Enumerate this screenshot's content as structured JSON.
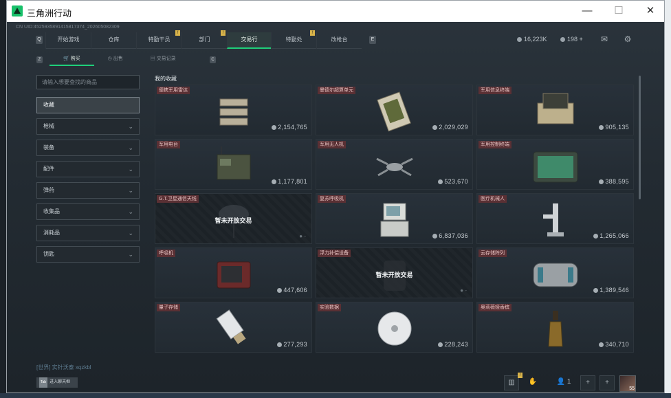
{
  "window": {
    "title": "三角洲行动",
    "min": "—",
    "max": "☐",
    "close": "✕"
  },
  "uid": "CN UID:4525935891415817374_202605082309",
  "nav": {
    "left_key": "Q",
    "right_key": "E",
    "tabs": [
      {
        "label": "开始游戏",
        "badge": ""
      },
      {
        "label": "仓库",
        "badge": ""
      },
      {
        "label": "特勤干员",
        "badge": "!"
      },
      {
        "label": "部门",
        "badge": "!"
      },
      {
        "label": "交易行",
        "badge": ""
      },
      {
        "label": "特勤处",
        "badge": "!"
      },
      {
        "label": "改枪台",
        "badge": ""
      }
    ]
  },
  "currency": {
    "hafu": "16,223K",
    "coupon": "198"
  },
  "subnav": {
    "left_key": "Z",
    "right_key": "C",
    "tabs": [
      "购买",
      "出售",
      "交易记录"
    ]
  },
  "search": {
    "placeholder": "请输入想要查找的商品"
  },
  "categories": [
    "收藏",
    "枪械",
    "装备",
    "配件",
    "弹药",
    "收集品",
    "消耗品",
    "钥匙"
  ],
  "section_title": "我的收藏",
  "locked_text": "暂未开放交易",
  "items": [
    {
      "name": "便携军用雷达",
      "price": "2,154,765",
      "icon": "radar-icon",
      "locked": false
    },
    {
      "name": "曼德尔超算单元",
      "price": "2,029,029",
      "icon": "circuit-board-icon",
      "locked": false
    },
    {
      "name": "军用信息终端",
      "price": "905,135",
      "icon": "terminal-case-icon",
      "locked": false
    },
    {
      "name": "军用电台",
      "price": "1,177,801",
      "icon": "radio-icon",
      "locked": false
    },
    {
      "name": "军用无人机",
      "price": "523,670",
      "icon": "drone-icon",
      "locked": false
    },
    {
      "name": "军用控制终端",
      "price": "388,595",
      "icon": "control-terminal-icon",
      "locked": false
    },
    {
      "name": "G.T.卫星通信天线",
      "price": "",
      "icon": "satellite-dish-icon",
      "locked": true
    },
    {
      "name": "复苏呼吸机",
      "price": "6,837,036",
      "icon": "ventilator-icon",
      "locked": false
    },
    {
      "name": "医疗机械人",
      "price": "1,265,066",
      "icon": "medical-robot-icon",
      "locked": false
    },
    {
      "name": "呼吸机",
      "price": "447,606",
      "icon": "monitor-icon",
      "locked": false
    },
    {
      "name": "浮力补偿设备",
      "price": "",
      "icon": "buoyancy-device-icon",
      "locked": true
    },
    {
      "name": "云存储阵列",
      "price": "1,389,546",
      "icon": "storage-array-icon",
      "locked": false
    },
    {
      "name": "量子存储",
      "price": "277,293",
      "icon": "usb-drive-icon",
      "locked": false
    },
    {
      "name": "实验数据",
      "price": "228,243",
      "icon": "disc-icon",
      "locked": false
    },
    {
      "name": "奥莉薇娅香槟",
      "price": "340,710",
      "icon": "champagne-icon",
      "locked": false
    }
  ],
  "chat": {
    "line": "[世界] 实针沃泰 xqzkbl",
    "btn_key": "Tab",
    "btn_label": "进入聊天框"
  },
  "bottom": {
    "level_badge": "!",
    "friends": "1",
    "avatar_level": "55"
  },
  "colors": {
    "accent": "#1fd07a",
    "tag_bg": "#5a3034",
    "badge": "#d8b34a"
  }
}
